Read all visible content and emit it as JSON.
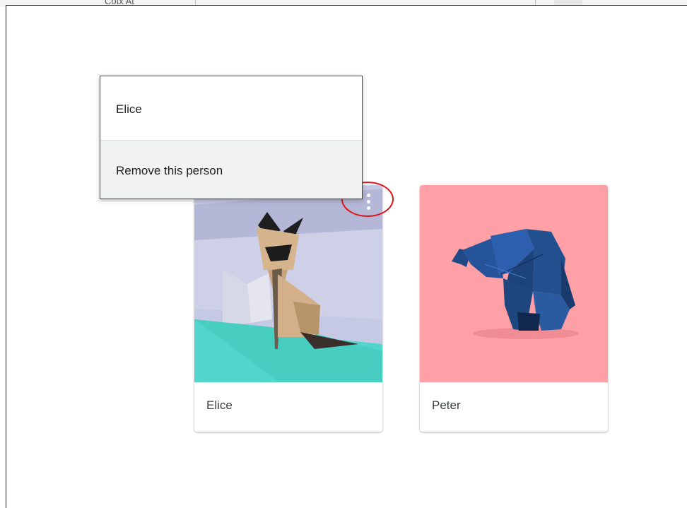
{
  "background": {
    "partial_text": "Cotx At"
  },
  "menu": {
    "header": "Elice",
    "items": [
      {
        "label": "Remove this person"
      }
    ]
  },
  "profiles": [
    {
      "name": "Elice",
      "artwork": "origami-cat",
      "background_colors": [
        "#c6c9e3",
        "#52d6cb"
      ]
    },
    {
      "name": "Peter",
      "artwork": "origami-elephant",
      "background_colors": [
        "#ff9fa6"
      ]
    }
  ],
  "colors": {
    "highlight": "#e0141e",
    "menu_hover": "#f1f3f3",
    "text": "#3c4043"
  }
}
